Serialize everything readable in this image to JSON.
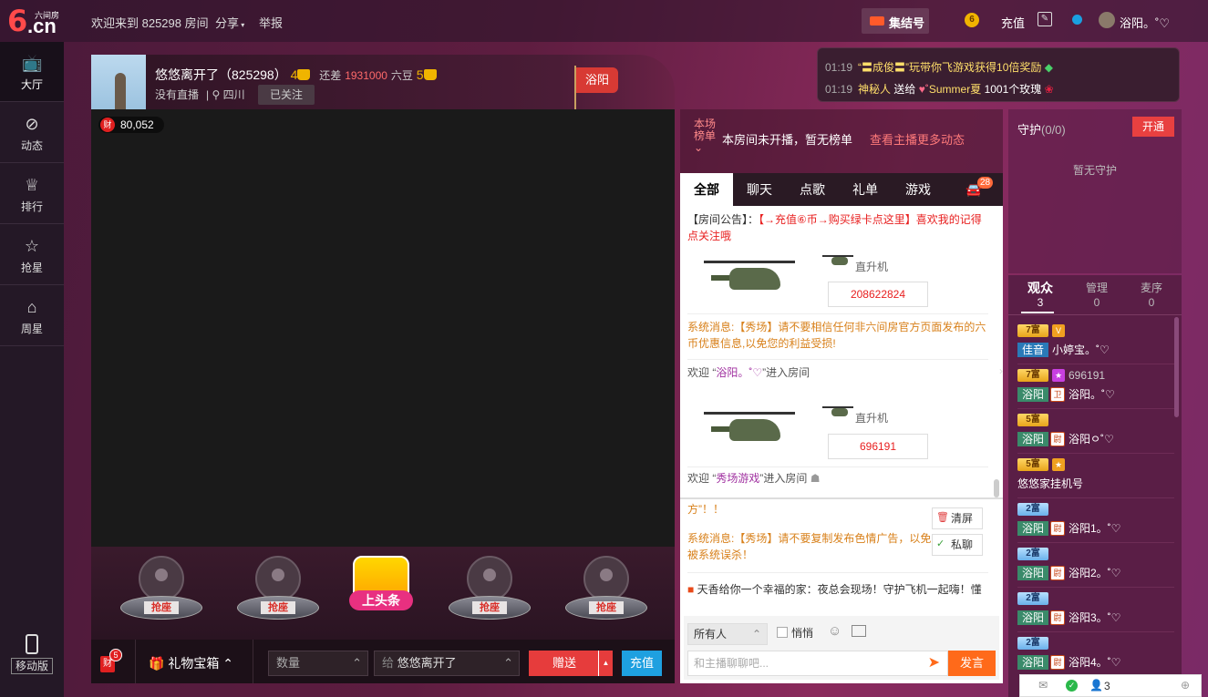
{
  "topbar": {
    "logo_main": "6",
    "logo_cn": ".cn",
    "logo_small": "六间房",
    "welcome": "欢迎来到 825298 房间",
    "share": "分享",
    "report": "举报",
    "jijiehao": "集结号",
    "recharge": "充值",
    "username": "浴阳。˚♡"
  },
  "sidebar": {
    "items": [
      {
        "label": "大厅",
        "icon": "tv-icon"
      },
      {
        "label": "动态",
        "icon": "compass-icon"
      },
      {
        "label": "排行",
        "icon": "crown-icon"
      },
      {
        "label": "抢星",
        "icon": "star-icon"
      },
      {
        "label": "周星",
        "icon": "basket-icon"
      }
    ],
    "mobile": "移动版"
  },
  "anchor": {
    "name": "悠悠离开了（825298）",
    "level_now": "4",
    "gap_label": "还差",
    "gap_value": "1931000",
    "gap_unit": "六豆",
    "level_next": "5",
    "status": "没有直播",
    "location": "四川",
    "follow_label": "已关注",
    "flag": "浴阳"
  },
  "video": {
    "wealth_icon": "财",
    "wealth_value": "80,052"
  },
  "seats": {
    "seat_label": "抢座",
    "headline_label": "上头条"
  },
  "bottombar": {
    "cai": "财",
    "cai_badge": "5",
    "gift_box": "礼物宝箱",
    "qty_placeholder": "数量",
    "to_label": "给",
    "to_name": "悠悠离开了",
    "send": "赠送",
    "recharge": "充值"
  },
  "notifications": [
    {
      "time": "01:19",
      "text": "“〓成俊〓”玩带你飞游戏获得10倍奖励"
    },
    {
      "time": "01:19",
      "sender": "神秘人",
      "verb": "送给",
      "target": "Summer夏",
      "gift": "1001个玫瑰"
    }
  ],
  "rank": {
    "label_top": "本场",
    "label_bottom": "榜单",
    "text": "本房间未开播，暂无榜单",
    "link": "查看主播更多动态"
  },
  "chat": {
    "tabs": [
      "全部",
      "聊天",
      "点歌",
      "礼单",
      "游戏"
    ],
    "car_count": "28",
    "announce_label": "【房间公告】：",
    "announce_red": "【→充值⑥币→购买绿卡点这里】喜欢我的记得点关注哦",
    "gift1_name": "直升机",
    "gift1_num": "208622824",
    "sys1": "系统消息:【秀场】请不要相信任何非六间房官方页面发布的六币优惠信息,以免您的利益受损!",
    "welcome1_pre": "欢迎 “",
    "welcome1_name": "浴阳。˚♡",
    "welcome1_post": "”进入房间",
    "gift2_name": "直升机",
    "gift2_num": "696191",
    "welcome2_pre": "欢迎 “",
    "welcome2_name": "秀场游戏",
    "welcome2_post": "”进入房间",
    "fang": "方”！！",
    "sys2": "系统消息:【秀场】请不要复制发布色情广告，以免被系统误杀！",
    "clear": "清屏",
    "private": "私聊",
    "broadcast": "天香给你一个幸福的家：夜总会现场！守护飞机一起嗨！懂",
    "recipient": "所有人",
    "whisper": "悄悄",
    "input_placeholder": "和主播聊聊吧...",
    "send": "发言"
  },
  "guard": {
    "title": "守护",
    "count": "(0/0)",
    "open": "开通",
    "empty": "暂无守护"
  },
  "users": {
    "tabs": [
      {
        "label": "观众",
        "count": "3"
      },
      {
        "label": "管理",
        "count": "0"
      },
      {
        "label": "麦序",
        "count": "0"
      }
    ],
    "rows": [
      {
        "level": "7富",
        "medal": "佳音",
        "name": "小婷宝。˚♡",
        "blue": true
      },
      {
        "level": "7富",
        "badge_text": "696191",
        "medal": "浴阳",
        "name": "浴阳。˚♡"
      },
      {
        "level": "5富",
        "medal": "浴阳",
        "name": "浴阳ㅇ˚♡"
      },
      {
        "level": "5富",
        "name": "悠悠家挂机号"
      },
      {
        "level": "2富",
        "medal": "浴阳",
        "name": "浴阳1。˚♡"
      },
      {
        "level": "2富",
        "medal": "浴阳",
        "name": "浴阳2。˚♡"
      },
      {
        "level": "2富",
        "medal": "浴阳",
        "name": "浴阳3。˚♡"
      },
      {
        "level": "2富",
        "medal": "浴阳",
        "name": "浴阳4。˚♡"
      }
    ]
  },
  "statusbar": {
    "count": "3"
  }
}
